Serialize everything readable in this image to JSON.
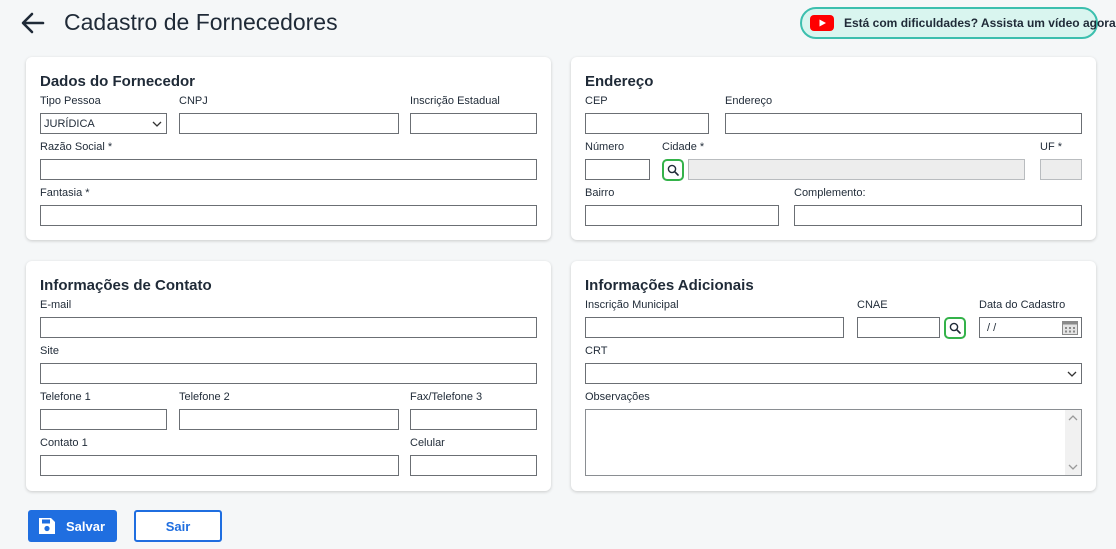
{
  "header": {
    "title": "Cadastro de Fornecedores",
    "help_text": "Está com dificuldades? Assista um vídeo agora!"
  },
  "colors": {
    "primary": "#1f6ee0",
    "search_green": "#34b24a",
    "banner_bg": "#d9f5ef",
    "banner_border": "#3cbfae",
    "youtube_red": "#ff0000"
  },
  "supplier": {
    "title": "Dados do Fornecedor",
    "tipo_pessoa_label": "Tipo Pessoa",
    "tipo_pessoa_value": "JURÍDICA",
    "cnpj_label": "CNPJ",
    "ie_label": "Inscrição Estadual",
    "razao_label": "Razão Social *",
    "fantasia_label": "Fantasia *"
  },
  "address": {
    "title": "Endereço",
    "cep_label": "CEP",
    "endereco_label": "Endereço",
    "numero_label": "Número",
    "cidade_label": "Cidade *",
    "uf_label": "UF *",
    "bairro_label": "Bairro",
    "complemento_label": "Complemento:"
  },
  "contact": {
    "title": "Informações de Contato",
    "email_label": "E-mail",
    "site_label": "Site",
    "tel1_label": "Telefone 1",
    "tel2_label": "Telefone 2",
    "fax_label": "Fax/Telefone 3",
    "contato_label": "Contato 1",
    "celular_label": "Celular"
  },
  "additional": {
    "title": "Informações Adicionais",
    "im_label": "Inscrição Municipal",
    "cnae_label": "CNAE",
    "data_label": "Data do Cadastro",
    "data_value": " / /",
    "crt_label": "CRT",
    "obs_label": "Observações"
  },
  "actions": {
    "save": "Salvar",
    "exit": "Sair"
  },
  "icons": [
    "arrow-left-icon",
    "youtube-icon",
    "chevron-down-icon",
    "search-icon",
    "calendar-icon",
    "floppy-disk-icon"
  ]
}
